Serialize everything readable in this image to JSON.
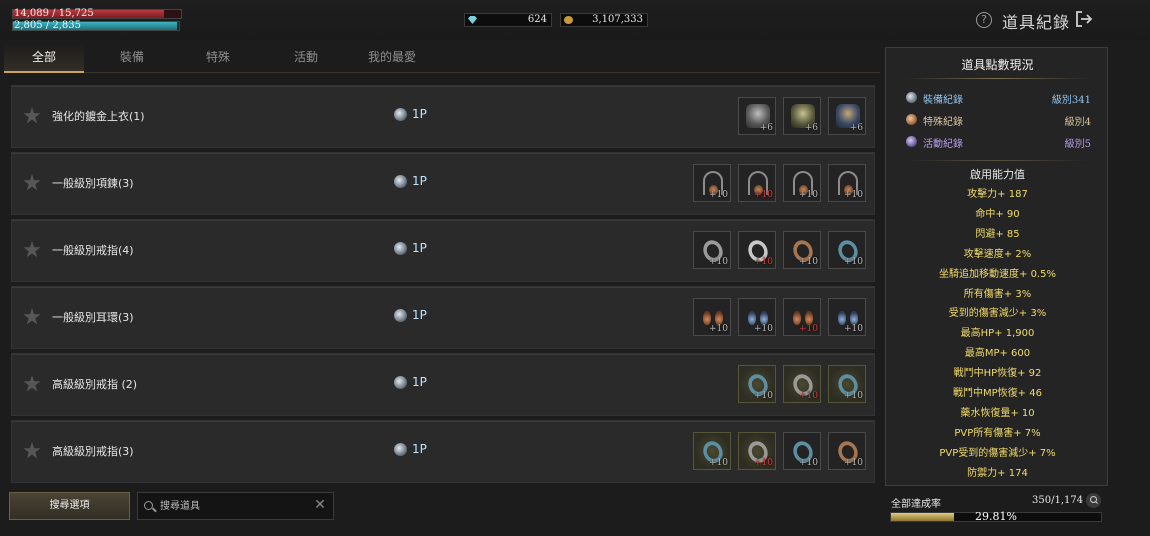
{
  "player": {
    "hp_text": "14,089 / 15,725",
    "hp_fraction": 0.896,
    "mp_text": "2,805 / 2,835",
    "mp_fraction": 0.989
  },
  "currency": {
    "gems": "624",
    "gold": "3,107,333"
  },
  "header": {
    "title": "道具紀錄",
    "help_glyph": "?"
  },
  "tabs": [
    {
      "label": "全部",
      "active": true
    },
    {
      "label": "裝備",
      "active": false
    },
    {
      "label": "特殊",
      "active": false
    },
    {
      "label": "活動",
      "active": false
    },
    {
      "label": "我的最愛",
      "active": false
    }
  ],
  "rows": [
    {
      "name": "強化的鍍金上衣(1)",
      "points": "1P",
      "items": [
        {
          "type": "armor",
          "variant": "",
          "enchant": "+6",
          "red": false,
          "gold": false
        },
        {
          "type": "armor",
          "variant": "gold",
          "enchant": "+6",
          "red": false,
          "gold": false
        },
        {
          "type": "armor",
          "variant": "blue",
          "enchant": "+6",
          "red": false,
          "gold": false
        }
      ]
    },
    {
      "name": "一般級別項鍊(3)",
      "points": "1P",
      "items": [
        {
          "type": "necklace",
          "variant": "",
          "enchant": "+10",
          "red": false,
          "gold": false
        },
        {
          "type": "necklace",
          "variant": "",
          "enchant": "+10",
          "red": true,
          "gold": false
        },
        {
          "type": "necklace",
          "variant": "",
          "enchant": "+10",
          "red": false,
          "gold": false
        },
        {
          "type": "necklace",
          "variant": "",
          "enchant": "+10",
          "red": false,
          "gold": false
        }
      ]
    },
    {
      "name": "一般級別戒指(4)",
      "points": "1P",
      "items": [
        {
          "type": "ring",
          "variant": "",
          "enchant": "+10",
          "red": false,
          "gold": false
        },
        {
          "type": "ring",
          "variant": "silver",
          "enchant": "+10",
          "red": true,
          "gold": false
        },
        {
          "type": "ring",
          "variant": "bronze",
          "enchant": "+10",
          "red": false,
          "gold": false
        },
        {
          "type": "ring",
          "variant": "blue",
          "enchant": "+10",
          "red": false,
          "gold": false
        }
      ]
    },
    {
      "name": "一般級別耳環(3)",
      "points": "1P",
      "items": [
        {
          "type": "earring",
          "variant": "",
          "enchant": "+10",
          "red": false,
          "gold": false
        },
        {
          "type": "earring",
          "variant": "blue",
          "enchant": "+10",
          "red": false,
          "gold": false
        },
        {
          "type": "earring",
          "variant": "",
          "enchant": "+10",
          "red": true,
          "gold": false
        },
        {
          "type": "earring",
          "variant": "blue",
          "enchant": "+10",
          "red": false,
          "gold": false
        }
      ]
    },
    {
      "name": "高級級別戒指 (2)",
      "points": "1P",
      "items": [
        {
          "type": "ring",
          "variant": "blue",
          "enchant": "+10",
          "red": false,
          "gold": true
        },
        {
          "type": "ring",
          "variant": "",
          "enchant": "+10",
          "red": true,
          "gold": true
        },
        {
          "type": "ring",
          "variant": "blue",
          "enchant": "+10",
          "red": false,
          "gold": true
        }
      ]
    },
    {
      "name": "高級級別戒指(3)",
      "points": "1P",
      "items": [
        {
          "type": "ring",
          "variant": "blue",
          "enchant": "+10",
          "red": false,
          "gold": true
        },
        {
          "type": "ring",
          "variant": "",
          "enchant": "+10",
          "red": true,
          "gold": true
        },
        {
          "type": "ring",
          "variant": "blue",
          "enchant": "+10",
          "red": false,
          "gold": false
        },
        {
          "type": "ring",
          "variant": "bronze",
          "enchant": "+10",
          "red": false,
          "gold": false
        }
      ]
    }
  ],
  "search": {
    "options_label": "搜尋選項",
    "placeholder": "搜尋道具"
  },
  "panel": {
    "title": "道具點數現況",
    "records": [
      {
        "kind": "equip",
        "label": "裝備紀錄",
        "level": "級別341"
      },
      {
        "kind": "special",
        "label": "特殊紀錄",
        "level": "級別4"
      },
      {
        "kind": "event",
        "label": "活動紀錄",
        "level": "級別5"
      }
    ],
    "stats_title": "啟用能力值",
    "stats": [
      "攻擊力+ 187",
      "命中+ 90",
      "閃避+ 85",
      "攻擊速度+ 2%",
      "坐騎追加移動速度+ 0.5%",
      "所有傷害+ 3%",
      "受到的傷害減少+ 3%",
      "最高HP+ 1,900",
      "最高MP+ 600",
      "戰鬥中HP恢復+ 92",
      "戰鬥中MP恢復+ 46",
      "藥水恢復量+ 10",
      "PVP所有傷害+ 7%",
      "PVP受到的傷害減少+ 7%",
      "防禦力+ 174"
    ]
  },
  "progress": {
    "label": "全部達成率",
    "count": "350/1,174",
    "percent_text": "29.81%",
    "fraction": 0.2981
  }
}
